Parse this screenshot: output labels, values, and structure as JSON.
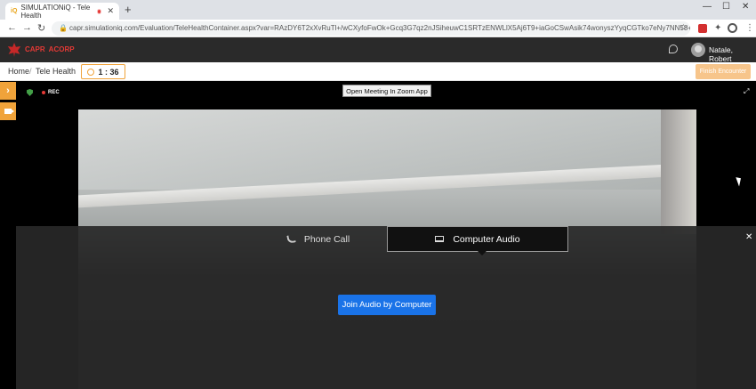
{
  "browser": {
    "tab_title": "SIMULATIONiQ - Tele Health",
    "favicon_text": "iQ",
    "url": "capr.simulationiq.com/Evaluation/TeleHealthContainer.aspx?var=RAzDY6T2xXvRuTl+/wCXyfoFwOk+Gcq3G7qz2nJSiheuwC1SRTzENWLlX5Aj6T9+iaGoCSwAsik74wonyszYyqCGTko7eNy7NN58+u8xR8QG...",
    "icons": [
      "back-icon",
      "forward-icon",
      "reload-icon",
      "lock-icon",
      "star-icon",
      "puzzle-icon",
      "profile-icon",
      "menu-icon"
    ]
  },
  "app": {
    "logo_en": "CAPR",
    "logo_fr": "ACORP",
    "user_name": "Natale, Robert"
  },
  "breadcrumb": {
    "home": "Home",
    "separator": "/",
    "current": "Tele Health"
  },
  "timer": "1 : 36",
  "finish_label": "Finish Encounter",
  "meeting": {
    "rec_label": "REC",
    "open_zoom_label": "Open Meeting In Zoom App",
    "tabs": [
      {
        "label": "Phone Call",
        "icon": "phone-icon",
        "active": false
      },
      {
        "label": "Computer Audio",
        "icon": "laptop-icon",
        "active": true
      }
    ],
    "join_label": "Join Audio by Computer"
  },
  "colors": {
    "accent_orange": "#f0a33a",
    "join_blue": "#1a73e8",
    "header_dark": "#2a2a2a"
  }
}
